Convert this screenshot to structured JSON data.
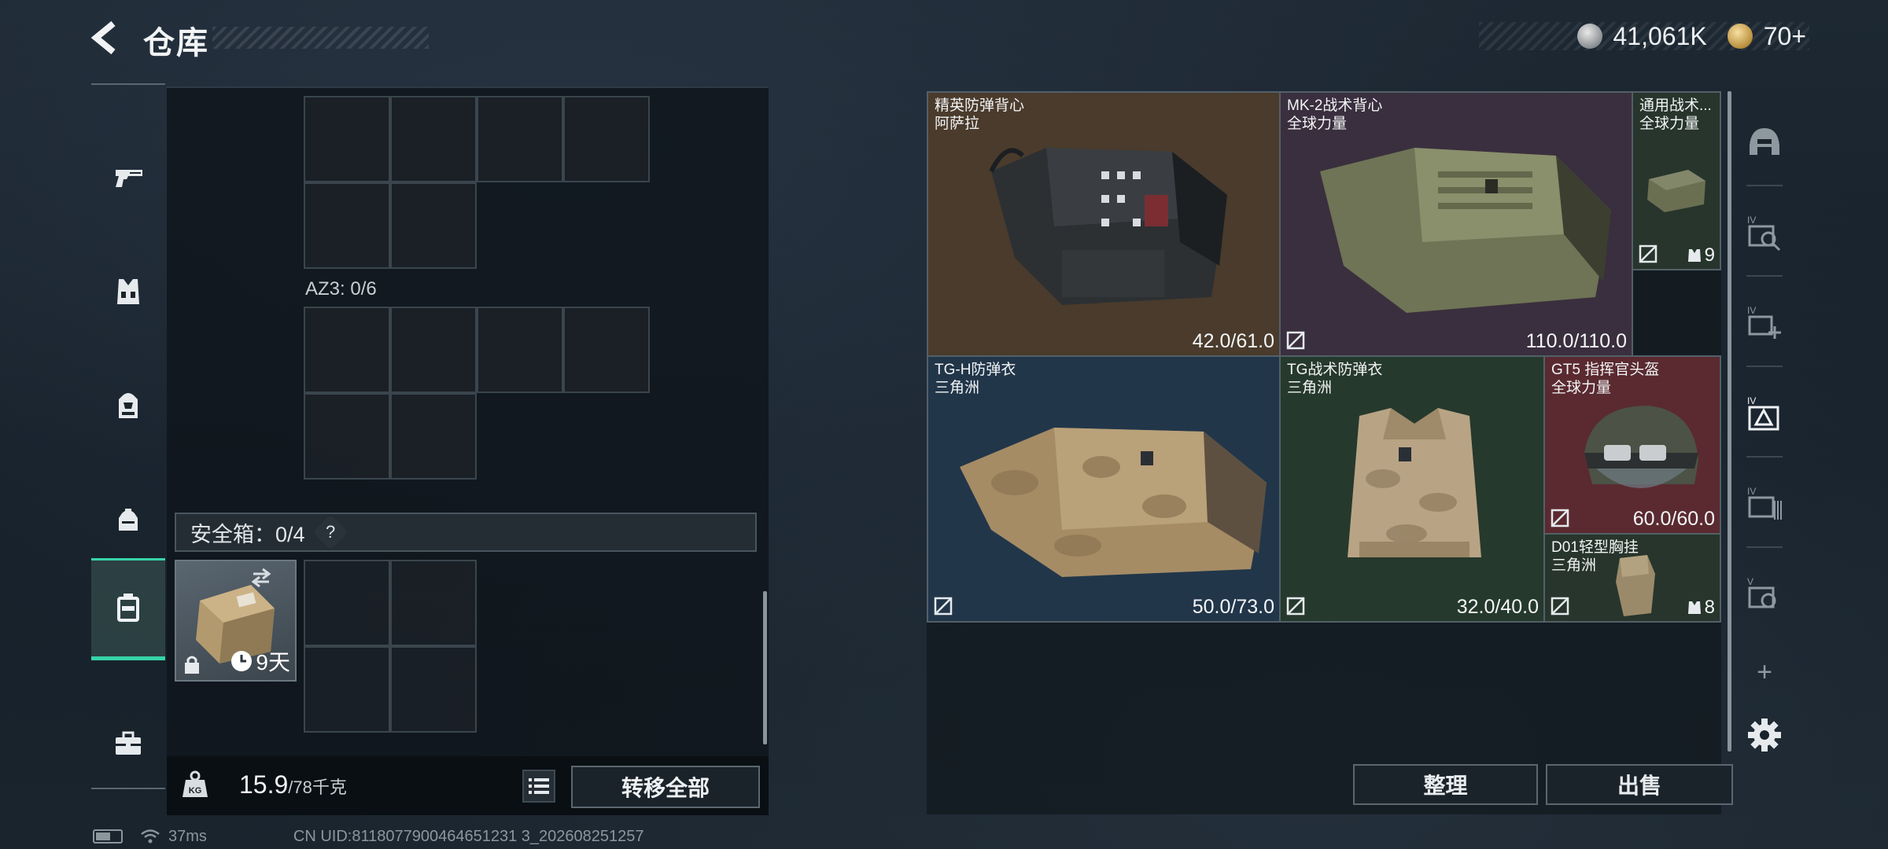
{
  "header": {
    "title": "仓库",
    "back_icon": "back-arrow-icon",
    "currencies": [
      {
        "icon": "silver-coin-icon",
        "value": "41,061K"
      },
      {
        "icon": "gold-coin-icon",
        "value": "70+"
      }
    ]
  },
  "left_sidebar": {
    "items": [
      {
        "icon": "pistol-icon",
        "active": false
      },
      {
        "icon": "vest-icon",
        "active": false
      },
      {
        "icon": "backpack-icon",
        "active": false
      },
      {
        "icon": "pouch-icon",
        "active": false
      },
      {
        "icon": "safe-box-icon",
        "active": true
      },
      {
        "icon": "briefcase-icon",
        "active": false
      }
    ]
  },
  "storage": {
    "az3_label": "AZ3: 0/6",
    "safe_box": {
      "label": "安全箱：0/4",
      "help": "?",
      "item": {
        "days": "9天",
        "icon": "secure-case-icon"
      }
    },
    "weight": {
      "current": "15.9",
      "max_unit": "/78千克"
    },
    "transfer_all": "转移全部"
  },
  "inventory_items": [
    {
      "name": "精英防弹背心",
      "faction": "阿萨拉",
      "durability": "42.0/61.0",
      "bg": "#4a3b2c"
    },
    {
      "name": "MK-2战术背心",
      "faction": "全球力量",
      "durability": "110.0/110.0",
      "bg": "#3a2f3e"
    },
    {
      "name": "通用战术...",
      "faction": "全球力量",
      "stack": "9",
      "bg": "#27352c"
    },
    {
      "name": "TG-H防弹衣",
      "faction": "三角洲",
      "durability": "50.0/73.0",
      "bg": "#22364a"
    },
    {
      "name": "TG战术防弹衣",
      "faction": "三角洲",
      "durability": "32.0/40.0",
      "bg": "#26392d"
    },
    {
      "name": "GT5 指挥官头盔",
      "faction": "全球力量",
      "durability": "60.0/60.0",
      "bg": "#5a2a30"
    },
    {
      "name": "D01轻型胸挂",
      "faction": "三角洲",
      "stack": "8",
      "bg": "#27352c"
    }
  ],
  "actions": {
    "sort": "整理",
    "sell": "出售"
  },
  "right_sidebar": {
    "items": [
      "helmet-icon",
      "iv-vest-icon",
      "iv-add-icon",
      "iv-armor-icon",
      "iv-bag-icon",
      "v-vest-icon",
      "add-icon",
      "gear-icon"
    ],
    "plus": "+"
  },
  "status": {
    "ping": "37ms",
    "uid": "CN UID:8118077900464651231 3_202608251257"
  }
}
